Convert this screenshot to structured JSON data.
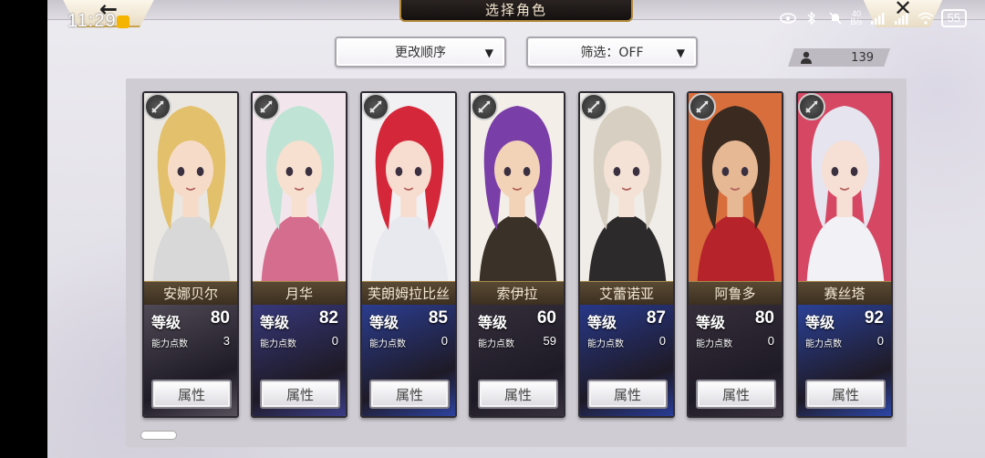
{
  "status_bar": {
    "time": "11:29",
    "net_speed": "40\nB/s",
    "battery": "55"
  },
  "header": {
    "title": "选择角色"
  },
  "filters": {
    "order_label": "更改顺序",
    "filter_label": "筛选：OFF"
  },
  "roster_count": "139",
  "labels": {
    "level": "等级",
    "points": "能力点数",
    "attribute_button": "属性"
  },
  "characters": [
    {
      "name": "安娜贝尔",
      "level": "80",
      "points": "3",
      "hair": "#e3c06b",
      "skin": "#f6dcc8",
      "outfit": "#d8d8d8",
      "bg": "#eae7e2",
      "panel": "#5b5560"
    },
    {
      "name": "月华",
      "level": "82",
      "points": "0",
      "hair": "#bfe3d5",
      "skin": "#f7e0d0",
      "outfit": "#d56d8e",
      "bg": "#f2e6ec",
      "panel": "#3d3f8f"
    },
    {
      "name": "芙朗姆拉比丝",
      "level": "85",
      "points": "0",
      "hair": "#d4283a",
      "skin": "#f7dcd0",
      "outfit": "#e8e8ef",
      "bg": "#f1f1f4",
      "panel": "#2e45a8"
    },
    {
      "name": "索伊拉",
      "level": "60",
      "points": "59",
      "hair": "#7a3ea8",
      "skin": "#f3d3b8",
      "outfit": "#3a3128",
      "bg": "#f3efe8",
      "panel": "#3a3340"
    },
    {
      "name": "艾蕾诺亚",
      "level": "87",
      "points": "0",
      "hair": "#d7d0c2",
      "skin": "#f5e2d6",
      "outfit": "#2d2a2c",
      "bg": "#f0ede8",
      "panel": "#2a3fa0"
    },
    {
      "name": "阿鲁多",
      "level": "80",
      "points": "0",
      "hair": "#3a2a20",
      "skin": "#e6b894",
      "outfit": "#b6232b",
      "bg": "#d86e3c",
      "panel": "#3c3440"
    },
    {
      "name": "赛丝塔",
      "level": "92",
      "points": "0",
      "hair": "#e6e4ee",
      "skin": "#f6dfd4",
      "outfit": "#f2f2f6",
      "bg": "#d64764",
      "panel": "#2e4ab2"
    }
  ]
}
